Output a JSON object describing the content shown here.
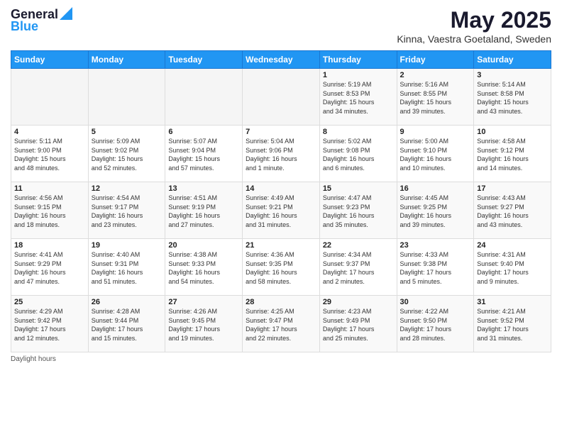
{
  "header": {
    "logo_text_general": "General",
    "logo_text_blue": "Blue",
    "title": "May 2025",
    "subtitle": "Kinna, Vaestra Goetaland, Sweden"
  },
  "days_of_week": [
    "Sunday",
    "Monday",
    "Tuesday",
    "Wednesday",
    "Thursday",
    "Friday",
    "Saturday"
  ],
  "weeks": [
    [
      {
        "day": "",
        "info": ""
      },
      {
        "day": "",
        "info": ""
      },
      {
        "day": "",
        "info": ""
      },
      {
        "day": "",
        "info": ""
      },
      {
        "day": "1",
        "info": "Sunrise: 5:19 AM\nSunset: 8:53 PM\nDaylight: 15 hours\nand 34 minutes."
      },
      {
        "day": "2",
        "info": "Sunrise: 5:16 AM\nSunset: 8:55 PM\nDaylight: 15 hours\nand 39 minutes."
      },
      {
        "day": "3",
        "info": "Sunrise: 5:14 AM\nSunset: 8:58 PM\nDaylight: 15 hours\nand 43 minutes."
      }
    ],
    [
      {
        "day": "4",
        "info": "Sunrise: 5:11 AM\nSunset: 9:00 PM\nDaylight: 15 hours\nand 48 minutes."
      },
      {
        "day": "5",
        "info": "Sunrise: 5:09 AM\nSunset: 9:02 PM\nDaylight: 15 hours\nand 52 minutes."
      },
      {
        "day": "6",
        "info": "Sunrise: 5:07 AM\nSunset: 9:04 PM\nDaylight: 15 hours\nand 57 minutes."
      },
      {
        "day": "7",
        "info": "Sunrise: 5:04 AM\nSunset: 9:06 PM\nDaylight: 16 hours\nand 1 minute."
      },
      {
        "day": "8",
        "info": "Sunrise: 5:02 AM\nSunset: 9:08 PM\nDaylight: 16 hours\nand 6 minutes."
      },
      {
        "day": "9",
        "info": "Sunrise: 5:00 AM\nSunset: 9:10 PM\nDaylight: 16 hours\nand 10 minutes."
      },
      {
        "day": "10",
        "info": "Sunrise: 4:58 AM\nSunset: 9:12 PM\nDaylight: 16 hours\nand 14 minutes."
      }
    ],
    [
      {
        "day": "11",
        "info": "Sunrise: 4:56 AM\nSunset: 9:15 PM\nDaylight: 16 hours\nand 18 minutes."
      },
      {
        "day": "12",
        "info": "Sunrise: 4:54 AM\nSunset: 9:17 PM\nDaylight: 16 hours\nand 23 minutes."
      },
      {
        "day": "13",
        "info": "Sunrise: 4:51 AM\nSunset: 9:19 PM\nDaylight: 16 hours\nand 27 minutes."
      },
      {
        "day": "14",
        "info": "Sunrise: 4:49 AM\nSunset: 9:21 PM\nDaylight: 16 hours\nand 31 minutes."
      },
      {
        "day": "15",
        "info": "Sunrise: 4:47 AM\nSunset: 9:23 PM\nDaylight: 16 hours\nand 35 minutes."
      },
      {
        "day": "16",
        "info": "Sunrise: 4:45 AM\nSunset: 9:25 PM\nDaylight: 16 hours\nand 39 minutes."
      },
      {
        "day": "17",
        "info": "Sunrise: 4:43 AM\nSunset: 9:27 PM\nDaylight: 16 hours\nand 43 minutes."
      }
    ],
    [
      {
        "day": "18",
        "info": "Sunrise: 4:41 AM\nSunset: 9:29 PM\nDaylight: 16 hours\nand 47 minutes."
      },
      {
        "day": "19",
        "info": "Sunrise: 4:40 AM\nSunset: 9:31 PM\nDaylight: 16 hours\nand 51 minutes."
      },
      {
        "day": "20",
        "info": "Sunrise: 4:38 AM\nSunset: 9:33 PM\nDaylight: 16 hours\nand 54 minutes."
      },
      {
        "day": "21",
        "info": "Sunrise: 4:36 AM\nSunset: 9:35 PM\nDaylight: 16 hours\nand 58 minutes."
      },
      {
        "day": "22",
        "info": "Sunrise: 4:34 AM\nSunset: 9:37 PM\nDaylight: 17 hours\nand 2 minutes."
      },
      {
        "day": "23",
        "info": "Sunrise: 4:33 AM\nSunset: 9:38 PM\nDaylight: 17 hours\nand 5 minutes."
      },
      {
        "day": "24",
        "info": "Sunrise: 4:31 AM\nSunset: 9:40 PM\nDaylight: 17 hours\nand 9 minutes."
      }
    ],
    [
      {
        "day": "25",
        "info": "Sunrise: 4:29 AM\nSunset: 9:42 PM\nDaylight: 17 hours\nand 12 minutes."
      },
      {
        "day": "26",
        "info": "Sunrise: 4:28 AM\nSunset: 9:44 PM\nDaylight: 17 hours\nand 15 minutes."
      },
      {
        "day": "27",
        "info": "Sunrise: 4:26 AM\nSunset: 9:45 PM\nDaylight: 17 hours\nand 19 minutes."
      },
      {
        "day": "28",
        "info": "Sunrise: 4:25 AM\nSunset: 9:47 PM\nDaylight: 17 hours\nand 22 minutes."
      },
      {
        "day": "29",
        "info": "Sunrise: 4:23 AM\nSunset: 9:49 PM\nDaylight: 17 hours\nand 25 minutes."
      },
      {
        "day": "30",
        "info": "Sunrise: 4:22 AM\nSunset: 9:50 PM\nDaylight: 17 hours\nand 28 minutes."
      },
      {
        "day": "31",
        "info": "Sunrise: 4:21 AM\nSunset: 9:52 PM\nDaylight: 17 hours\nand 31 minutes."
      }
    ]
  ],
  "footer": {
    "note": "Daylight hours"
  }
}
